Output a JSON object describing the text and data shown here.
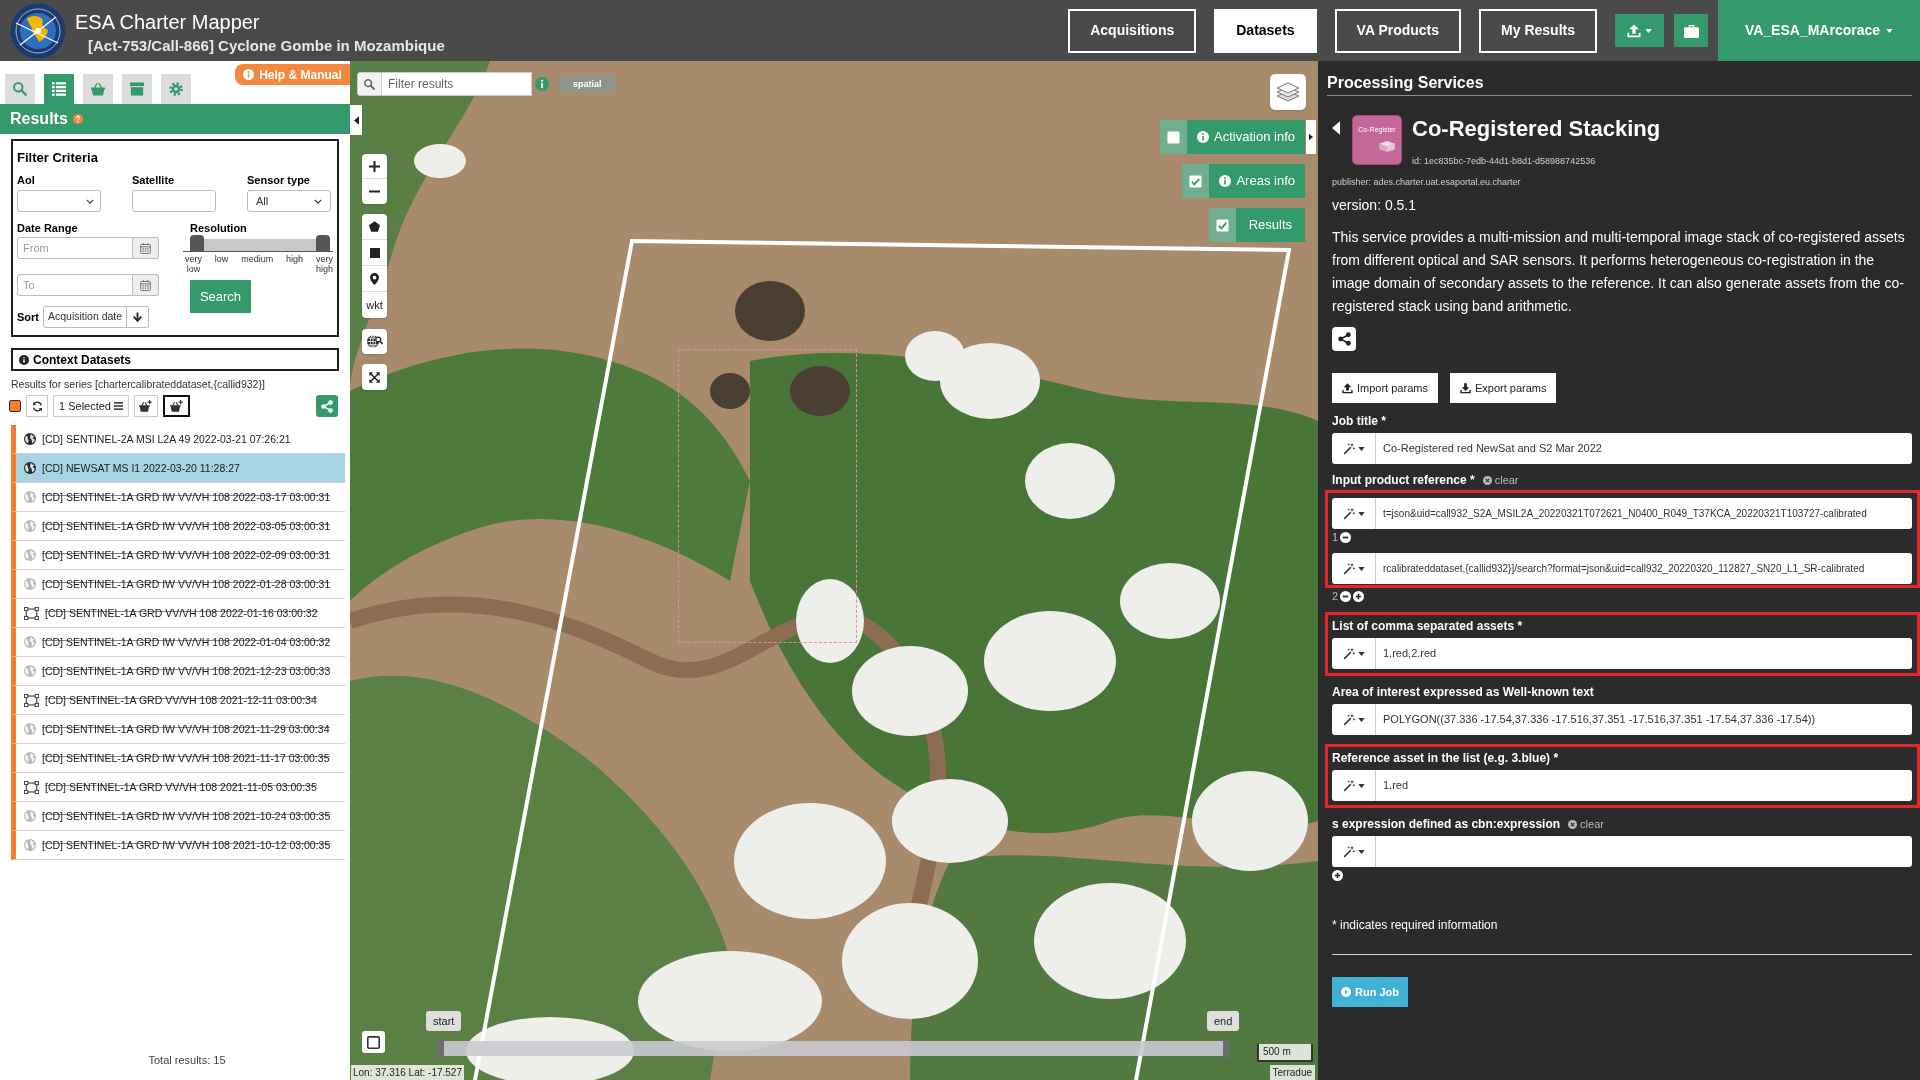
{
  "header": {
    "app_title": "ESA Charter Mapper",
    "subtitle": "[Act-753/Call-866] Cyclone Gombe in Mozambique",
    "nav": [
      {
        "label": "Acquisitions",
        "selected": false
      },
      {
        "label": "Datasets",
        "selected": true
      },
      {
        "label": "VA Products",
        "selected": false
      },
      {
        "label": "My Results",
        "selected": false
      }
    ],
    "user": "VA_ESA_MArcorace"
  },
  "left_panel": {
    "tabs": [
      {
        "kind": "search",
        "selected": false
      },
      {
        "kind": "list",
        "selected": true
      },
      {
        "kind": "basket",
        "selected": false
      },
      {
        "kind": "archive",
        "selected": false
      },
      {
        "kind": "settings",
        "selected": false
      }
    ],
    "help_label": "Help & Manual",
    "title": "Results",
    "filter": {
      "title": "Filter Criteria",
      "aoi_label": "AoI",
      "satellite_label": "Satellite",
      "sensor_label": "Sensor type",
      "sensor_value": "All",
      "date_label": "Date Range",
      "from_field": {
        "placeholder": "From"
      },
      "to_field": {
        "placeholder": "To"
      },
      "resolution_label": "Resolution",
      "resolution_ticks": [
        "very low",
        "low",
        "medium",
        "high",
        "very high"
      ],
      "resolution_handles": [
        {
          "level": 0
        },
        {
          "level": 1
        }
      ],
      "search_label": "Search",
      "sort_label": "Sort",
      "sort_value": "Acquisition date"
    },
    "context": {
      "title": "Context Datasets",
      "series": "Results for series [chartercalibrateddataset,{callid932}]",
      "select_all_checked": true,
      "selection": "1 Selected"
    },
    "results": [
      {
        "label": "[CD] SENTINEL-2A MSI L2A 49 2022-03-21 07:26:21",
        "kind": "globe",
        "selected": false,
        "strikethrough": false
      },
      {
        "label": "[CD] NEWSAT MS I1 2022-03-20 11:28:27",
        "kind": "globe",
        "selected": true,
        "strikethrough": false
      },
      {
        "label": "[CD] SENTINEL-1A GRD IW VV/VH 108 2022-03-17 03:00:31",
        "kind": "globe",
        "selected": false,
        "strikethrough": true
      },
      {
        "label": "[CD] SENTINEL-1A GRD IW VV/VH 108 2022-03-05 03:00:31",
        "kind": "globe",
        "selected": false,
        "strikethrough": true
      },
      {
        "label": "[CD] SENTINEL-1A GRD IW VV/VH 108 2022-02-09 03:00:31",
        "kind": "globe",
        "selected": false,
        "strikethrough": true
      },
      {
        "label": "[CD] SENTINEL-1A GRD IW VV/VH 108 2022-01-28 03:00:31",
        "kind": "globe",
        "selected": false,
        "strikethrough": true
      },
      {
        "label": "[CD] SENTINEL-1A GRD VV/VH 108 2022-01-16 03:00:32",
        "kind": "footprint",
        "selected": false,
        "strikethrough": true
      },
      {
        "label": "[CD] SENTINEL-1A GRD IW VV/VH 108 2022-01-04 03:00:32",
        "kind": "globe",
        "selected": false,
        "strikethrough": true
      },
      {
        "label": "[CD] SENTINEL-1A GRD IW VV/VH 108 2021-12-23 03:00:33",
        "kind": "globe",
        "selected": false,
        "strikethrough": true
      },
      {
        "label": "[CD] SENTINEL-1A GRD VV/VH 108 2021-12-11 03:00:34",
        "kind": "footprint",
        "selected": false,
        "strikethrough": true
      },
      {
        "label": "[CD] SENTINEL-1A GRD IW VV/VH 108 2021-11-29 03:00:34",
        "kind": "globe",
        "selected": false,
        "strikethrough": true
      },
      {
        "label": "[CD] SENTINEL-1A GRD IW VV/VH 108 2021-11-17 03:00:35",
        "kind": "globe",
        "selected": false,
        "strikethrough": true
      },
      {
        "label": "[CD] SENTINEL-1A GRD VV/VH 108 2021-11-05 03:00:35",
        "kind": "footprint",
        "selected": false,
        "strikethrough": true
      },
      {
        "label": "[CD] SENTINEL-1A GRD IW VV/VH 108 2021-10-24 03:00:35",
        "kind": "globe",
        "selected": false,
        "strikethrough": true
      },
      {
        "label": "[CD] SENTINEL-1A GRD IW VV/VH 108 2021-10-12 03:00:35",
        "kind": "globe",
        "selected": false,
        "strikethrough": true
      }
    ],
    "total": "Total results: 15"
  },
  "map": {
    "filter_field": {
      "placeholder": "Filter results"
    },
    "filter_tag": "spatial",
    "wkt_label": "wkt",
    "layers": [
      {
        "label": "Activation info",
        "checked": false,
        "info": true
      },
      {
        "label": "Areas info",
        "checked": true,
        "info": true
      },
      {
        "label": "Results",
        "checked": true,
        "info": false
      }
    ],
    "timeline": {
      "start": "start",
      "end": "end",
      "handles": [
        {
          "level": 0
        },
        {
          "level": 1
        }
      ]
    },
    "scale": "500 m",
    "coordinates": "Lon: 37.316 Lat: -17.527",
    "attribution": "Terradue"
  },
  "processing": {
    "title": "Processing Services",
    "service": {
      "name": "Co-Registered Stacking",
      "tile_text": "Co-Register",
      "id": "id: 1ec835bc-7edb-44d1-b8d1-d58988742536",
      "publisher": "publisher: ades.charter.uat.esaportal.eu.charter",
      "version": "version: 0.5.1",
      "description": "This service provides a multi-mission and multi-temporal image stack of co-registered assets from different optical and SAR sensors. It performs heterogeneous co-registration in the image domain of secondary assets to the reference. It can also generate assets from the co-registered stack using band arithmetic."
    },
    "import_label": "Import params",
    "export_label": "Export params",
    "params": [
      {
        "label": "Job title *",
        "kind": "single",
        "highlighted": false,
        "addable": false,
        "values": [
          {
            "value": "Co-Registered red NewSat and S2 Mar 2022",
            "removable": false
          }
        ]
      },
      {
        "label": "Input product reference *",
        "kind": "list",
        "clear": "clear",
        "highlighted": true,
        "addable": true,
        "values": [
          {
            "index": "1",
            "value": "t=json&uid=call932_S2A_MSIL2A_20220321T072621_N0400_R049_T37KCA_20220321T103727-calibrated",
            "removable": true
          },
          {
            "index": "2",
            "value": "rcalibrateddataset,{callid932}]/search?format=json&uid=call932_20220320_112827_SN20_L1_SR-calibrated",
            "removable": true
          }
        ]
      },
      {
        "label": "List of comma separated assets *",
        "kind": "single",
        "highlighted": true,
        "addable": false,
        "values": [
          {
            "value": "1.red,2.red",
            "removable": false
          }
        ]
      },
      {
        "label": "Area of interest expressed as Well-known text",
        "kind": "single",
        "highlighted": false,
        "addable": false,
        "values": [
          {
            "value": "POLYGON((37.336 -17.54,37.336 -17.516,37.351 -17.516,37.351 -17.54,37.336 -17.54))",
            "removable": false
          }
        ]
      },
      {
        "label": "Reference asset in the list (e.g. 3.blue) *",
        "kind": "single",
        "highlighted": true,
        "addable": false,
        "values": [
          {
            "value": "1.red",
            "removable": false
          }
        ]
      },
      {
        "label": "s expression defined as cbn:expression",
        "kind": "list",
        "clear": "clear",
        "highlighted": false,
        "addable": true,
        "values": [
          {
            "removable": false
          }
        ]
      }
    ],
    "required_note": "* indicates required information",
    "run_label": "Run Job"
  }
}
